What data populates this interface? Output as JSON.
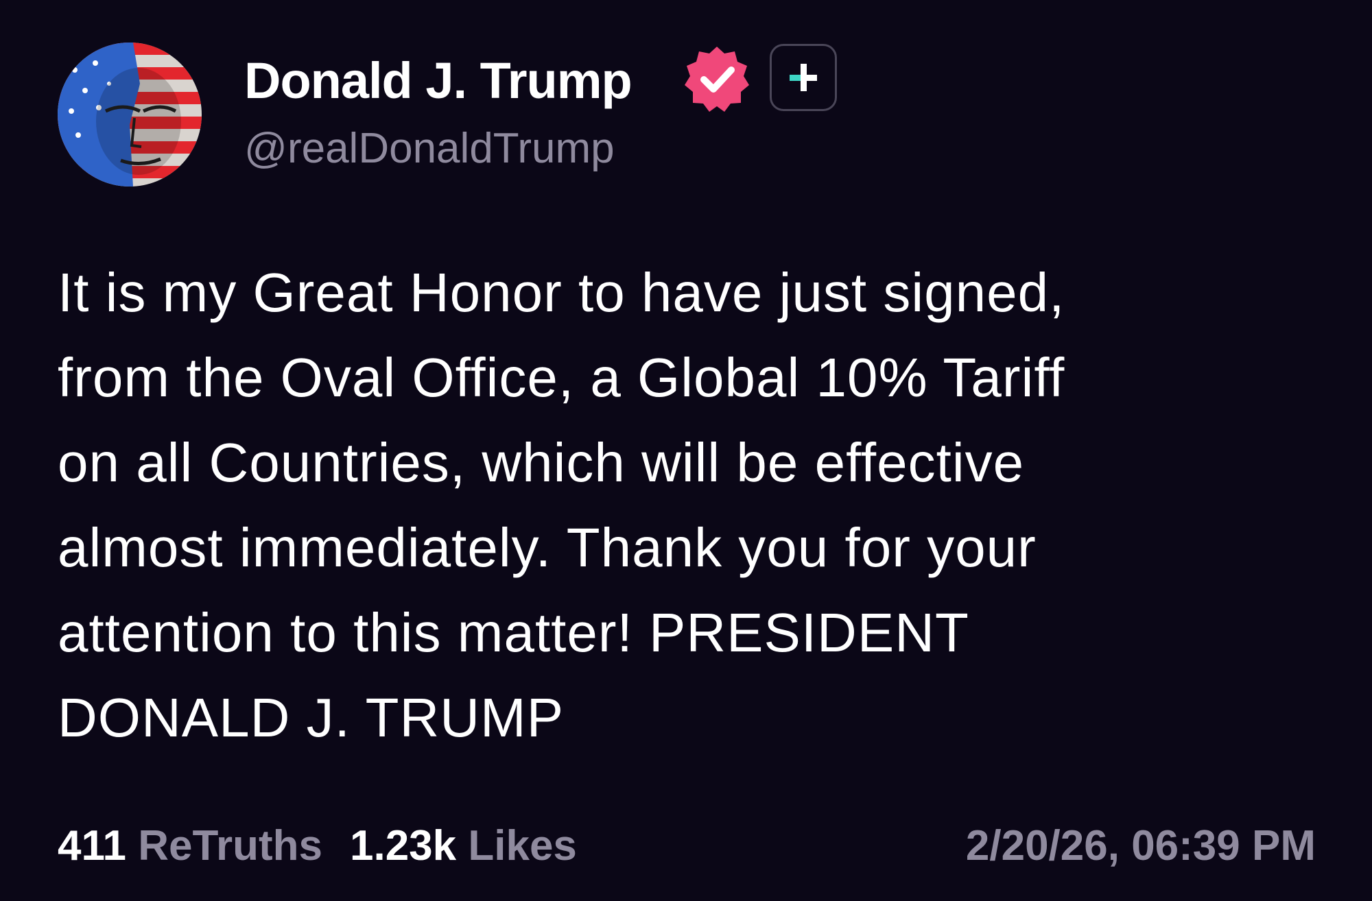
{
  "author": {
    "display_name": "Donald J. Trump",
    "handle": "@realDonaldTrump",
    "avatar_icon": "flag-face-avatar",
    "verified_icon": "verified-check-icon",
    "plus_icon": "follow-plus-icon"
  },
  "post": {
    "text": "It is my Great Honor to have just signed,\nfrom the Oval Office, a Global 10% Tariff\non all Countries, which will be effective\nalmost immediately. Thank you for your\nattention to this matter! PRESIDENT\nDONALD J. TRUMP"
  },
  "stats": {
    "retruths_count": "411",
    "retruths_label": "ReTruths",
    "likes_count": "1.23k",
    "likes_label": "Likes",
    "timestamp": "2/20/26, 06:39 PM"
  },
  "colors": {
    "background": "#0b0717",
    "muted_text": "#8f8a9e",
    "verified_badge": "#f0487a",
    "plus_accent": "#3fd6c6"
  }
}
